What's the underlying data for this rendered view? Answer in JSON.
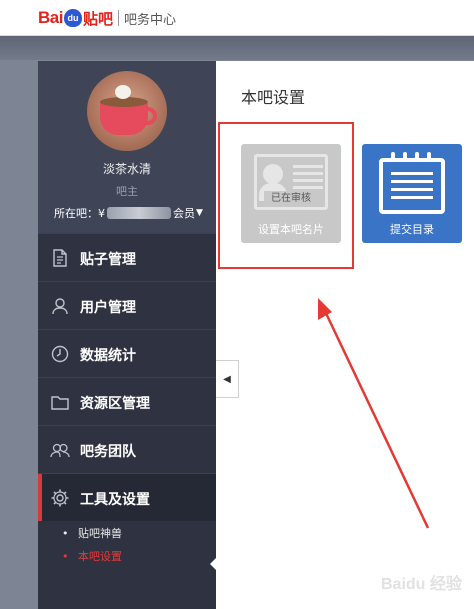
{
  "header": {
    "logo_bai": "Bai",
    "logo_du": "du",
    "logo_tieba": "贴吧",
    "center_title": "吧务中心"
  },
  "profile": {
    "name": "淡茶水清",
    "role": "吧主",
    "location_prefix": "所在吧：",
    "location_visible_start": "¥",
    "location_visible_end": "会员"
  },
  "menu": [
    {
      "label": "贴子管理",
      "icon": "document-icon"
    },
    {
      "label": "用户管理",
      "icon": "user-icon"
    },
    {
      "label": "数据统计",
      "icon": "clock-icon"
    },
    {
      "label": "资源区管理",
      "icon": "folder-icon"
    },
    {
      "label": "吧务团队",
      "icon": "team-icon"
    },
    {
      "label": "工具及设置",
      "icon": "gear-icon",
      "active": true
    }
  ],
  "submenu": [
    {
      "label": "贴吧神兽"
    },
    {
      "label": "本吧设置",
      "active": true
    }
  ],
  "main": {
    "title": "本吧设置",
    "tiles": [
      {
        "label": "设置本吧名片",
        "badge": "已在审核",
        "icon": "id-card-icon",
        "color": "#c8c8c8"
      },
      {
        "label": "提交目录",
        "icon": "notebook-icon",
        "color": "#3a74c6"
      }
    ]
  },
  "collapse_glyph": "◀",
  "watermark": "Baidu 经验",
  "colors": {
    "accent_red": "#e53935",
    "sidebar_bg": "#2f3341",
    "tile_blue": "#3a74c6"
  }
}
